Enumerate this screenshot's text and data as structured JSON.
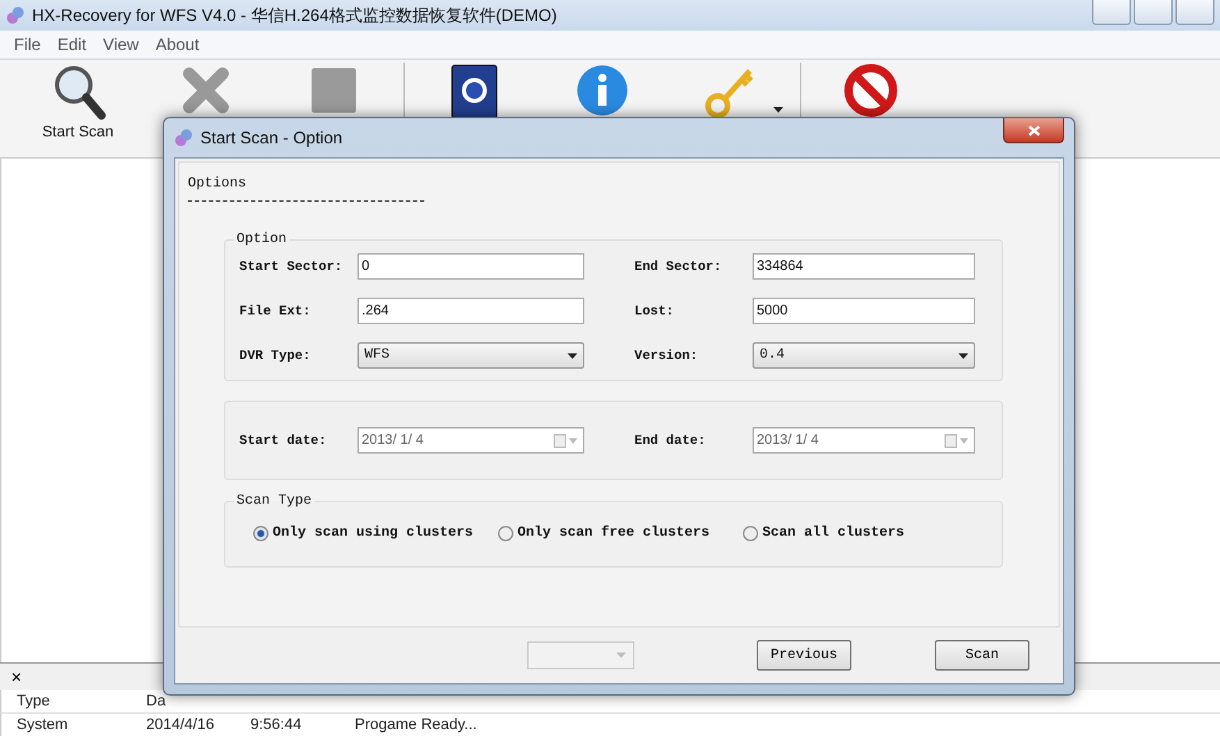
{
  "window": {
    "title": "HX-Recovery for WFS  V4.0  - 华信H.264格式监控数据恢复软件(DEMO)"
  },
  "menu": [
    "File",
    "Edit",
    "View",
    "About"
  ],
  "toolbar": [
    {
      "kind": "search",
      "label": "Start Scan"
    },
    {
      "kind": "delete"
    },
    {
      "kind": "disk"
    },
    {
      "kind": "separator"
    },
    {
      "kind": "help"
    },
    {
      "kind": "info"
    },
    {
      "kind": "key",
      "dropdown": true
    },
    {
      "kind": "separator"
    },
    {
      "kind": "stop"
    }
  ],
  "log": {
    "close": "×",
    "columns": [
      "Type",
      "Da"
    ],
    "rows": [
      [
        "System",
        "2014/4/16",
        "9:56:44",
        "Progame Ready..."
      ]
    ]
  },
  "dialog": {
    "title": "Start Scan - Option",
    "tab": "Options",
    "option_group": {
      "legend": "Option",
      "fields": [
        {
          "label": "Start Sector:",
          "value": "0",
          "kind": "text"
        },
        {
          "label": "End Sector:",
          "value": "334864",
          "kind": "text"
        },
        {
          "label": "File Ext:",
          "value": ".264",
          "kind": "text"
        },
        {
          "label": "Lost:",
          "value": "5000",
          "kind": "text"
        },
        {
          "label": "DVR Type:",
          "value": "WFS",
          "kind": "select"
        },
        {
          "label": "Version:",
          "value": "0.4",
          "kind": "select"
        }
      ]
    },
    "date_group": {
      "fields": [
        {
          "label": "Start date:",
          "value": "2013/ 1/ 4",
          "disabled": true
        },
        {
          "label": "End date:",
          "value": "2013/ 1/ 4",
          "disabled": true
        }
      ]
    },
    "scan_type": {
      "legend": "Scan Type",
      "options": [
        {
          "label": "Only scan using clusters",
          "selected": true
        },
        {
          "label": "Only scan free clusters",
          "selected": false
        },
        {
          "label": "Scan all clusters",
          "selected": false
        }
      ]
    },
    "footer": [
      {
        "kind": "select",
        "disabled": true
      },
      {
        "kind": "button",
        "label": "Previous"
      },
      {
        "kind": "button",
        "label": "Scan"
      }
    ]
  }
}
